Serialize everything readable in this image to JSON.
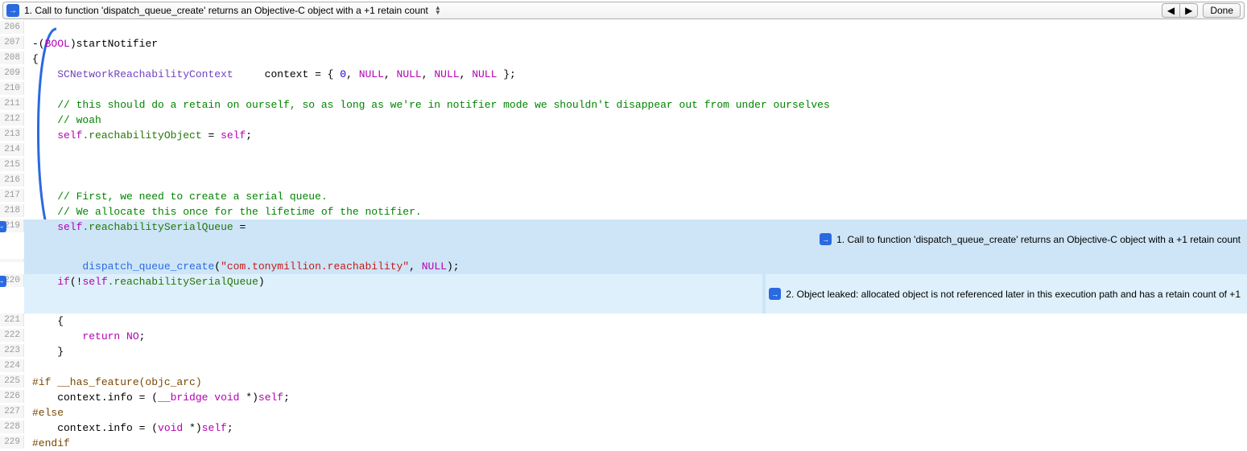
{
  "toolbar": {
    "issue_title": "1. Call to function 'dispatch_queue_create' returns an Objective-C object with a +1 retain count",
    "prev_label": "◀",
    "next_label": "▶",
    "done_label": "Done"
  },
  "annotations": {
    "a1": "1. Call to function 'dispatch_queue_create' returns an Objective-C object with a +1 retain count",
    "a2": "2. Object leaked: allocated object is not referenced later in this execution path and has a retain count of +1"
  },
  "lines": {
    "206": "",
    "207": {
      "pre": "-(",
      "kw": "BOOL",
      "post": ")startNotifier"
    },
    "208": "{",
    "209": {
      "indent": "    ",
      "type": "SCNetworkReachabilityContext",
      "mid": "     context = { ",
      "num": "0",
      "n1": "NULL",
      "n2": "NULL",
      "n3": "NULL",
      "n4": "NULL",
      "tail": " };"
    },
    "210": "",
    "211": "    // this should do a retain on ourself, so as long as we're in notifier mode we shouldn't disappear out from under ourselves",
    "212": "    // woah",
    "213": {
      "indent": "    ",
      "self": "self",
      "mem": ".reachabilityObject",
      "eq": " = ",
      "self2": "self",
      "tail": ";"
    },
    "214": "",
    "215": "",
    "216": "",
    "217": "    // First, we need to create a serial queue.",
    "218": "    // We allocate this once for the lifetime of the notifier.",
    "219": {
      "indent": "    ",
      "self": "self",
      "mem": ".reachabilitySerialQueue",
      "tail": " ="
    },
    "219b": {
      "indent": "        ",
      "fn": "dispatch_queue_create",
      "lp": "(",
      "str": "\"com.tonymillion.reachability\"",
      "comma": ", ",
      "null": "NULL",
      "rp": ");"
    },
    "220": {
      "indent": "    ",
      "ifkw": "if",
      "lp": "(!",
      "self": "self",
      "mem": ".reachabilitySerialQueue",
      "rp": ")"
    },
    "221": "    {",
    "222": {
      "indent": "        ",
      "ret": "return",
      "sp": " ",
      "no": "NO",
      "tail": ";"
    },
    "223": "    }",
    "224": "",
    "225": {
      "pre": "#if",
      "cond": " __has_feature(objc_arc)"
    },
    "226": {
      "indent": "    context.info = (",
      "kw1": "__bridge",
      "sp": " ",
      "kw2": "void",
      "star": " *)",
      "self": "self",
      "tail": ";"
    },
    "227": "#else",
    "228": {
      "indent": "    context.info = (",
      "kw": "void",
      "star": " *)",
      "self": "self",
      "tail": ";"
    },
    "229": "#endif"
  },
  "line_numbers": [
    "206",
    "207",
    "208",
    "209",
    "210",
    "211",
    "212",
    "213",
    "214",
    "215",
    "216",
    "217",
    "218",
    "219",
    "",
    "220",
    "221",
    "222",
    "223",
    "224",
    "225",
    "226",
    "227",
    "228",
    "229"
  ]
}
